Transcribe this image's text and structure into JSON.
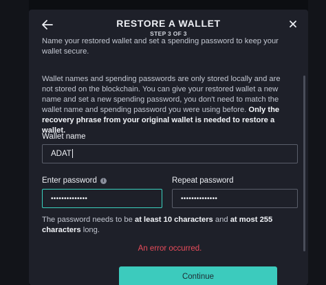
{
  "dialog": {
    "title": "RESTORE A WALLET",
    "step": "STEP 3 OF 3",
    "intro": "Name your restored wallet and set a spending password to keep your wallet secure.",
    "description_plain": "Wallet names and spending passwords are only stored locally and are not stored on the blockchain. You can give your restored wallet a new name and set a new spending password, you don't need to match the wallet name and spending password you were using before. ",
    "description_bold": "Only the recovery phrase from your original wallet is needed to restore a wallet.",
    "wallet_name_label": "Wallet name",
    "wallet_name_value": "ADAT",
    "enter_password_label": "Enter password",
    "enter_password_value": "••••••••••••••",
    "repeat_password_label": "Repeat password",
    "repeat_password_value": "••••••••••••••",
    "hint_part1": "The password needs to be ",
    "hint_bold1": "at least 10 characters",
    "hint_part2": " and ",
    "hint_bold2": "at most 255 characters",
    "hint_part3": " long.",
    "error_text": "An error occurred.",
    "continue_label": "Continue"
  },
  "icons": {
    "back": "arrow-left-icon",
    "close": "close-icon",
    "info": "info-icon"
  },
  "colors": {
    "accent": "#3ccbbd",
    "error": "#ea4c5b",
    "dialog_bg": "#1e2029"
  }
}
